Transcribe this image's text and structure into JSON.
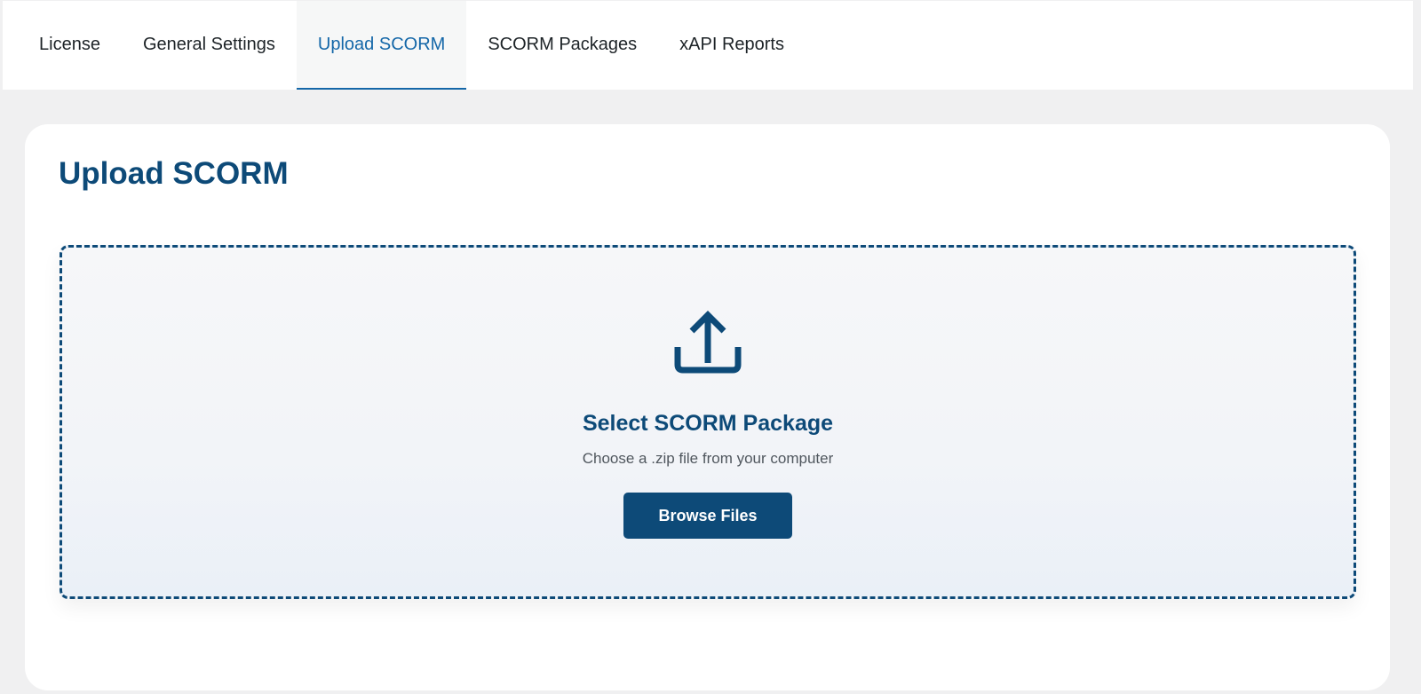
{
  "tabs": [
    {
      "label": "License",
      "active": false
    },
    {
      "label": "General Settings",
      "active": false
    },
    {
      "label": "Upload SCORM",
      "active": true
    },
    {
      "label": "SCORM Packages",
      "active": false
    },
    {
      "label": "xAPI Reports",
      "active": false
    }
  ],
  "card": {
    "title": "Upload SCORM"
  },
  "dropzone": {
    "icon": "upload-icon",
    "title": "Select SCORM Package",
    "subtitle": "Choose a .zip file from your computer",
    "button_label": "Browse Files"
  },
  "colors": {
    "primary": "#0d4a78",
    "active_tab": "#1467a8",
    "page_bg": "#f0f0f1"
  }
}
